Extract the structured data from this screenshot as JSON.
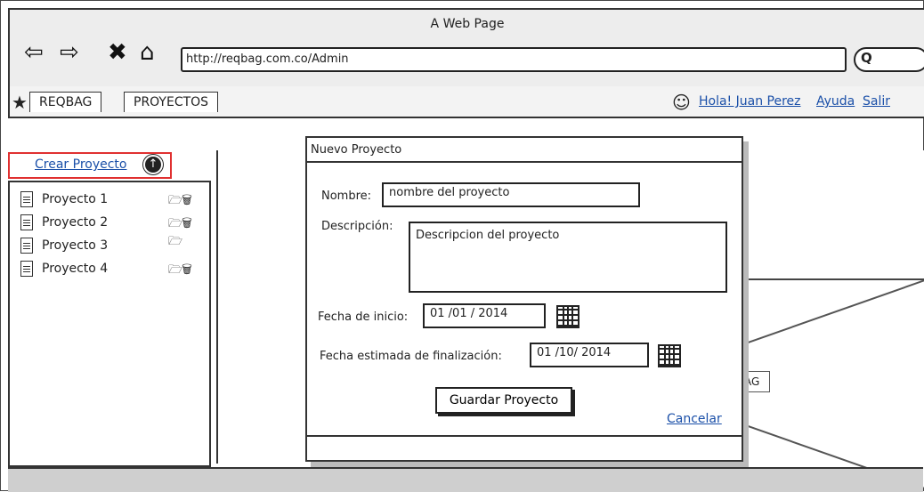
{
  "window": {
    "title": "A Web Page",
    "nav_icons": [
      "back-arrow-icon",
      "forward-arrow-icon",
      "stop-icon",
      "home-icon"
    ],
    "url": "http://reqbag.com.co/Admin",
    "search_glyph": "Q"
  },
  "menubar": {
    "tabs": [
      {
        "label": "REQBAG"
      },
      {
        "label": "PROYECTOS"
      }
    ],
    "greeting": "Hola! Juan Perez",
    "help": "Ayuda",
    "logout": "Salir"
  },
  "sidebar": {
    "create_label": "Crear Proyecto",
    "projects": [
      {
        "name": "Proyecto 1",
        "actions": [
          "open-folder-icon",
          "trash-icon"
        ]
      },
      {
        "name": "Proyecto 2",
        "actions": [
          "open-folder-icon",
          "trash-icon"
        ]
      },
      {
        "name": "Proyecto 3",
        "actions": [
          "open-folder-icon"
        ]
      },
      {
        "name": "Proyecto 4",
        "actions": [
          "open-folder-icon",
          "trash-icon"
        ]
      }
    ]
  },
  "background": {
    "partial_button_text": "AG"
  },
  "dialog": {
    "title": "Nuevo Proyecto",
    "name_label": "Nombre:",
    "name_value": "nombre del proyecto",
    "description_label": "Descripción:",
    "description_value": "Descripcion del proyecto",
    "start_label": "Fecha de inicio:",
    "start_value": "01 /01 / 2014",
    "end_label": "Fecha estimada de finalización:",
    "end_value": "01 /10/ 2014",
    "save_label": "Guardar Proyecto",
    "cancel_label": "Cancelar"
  }
}
